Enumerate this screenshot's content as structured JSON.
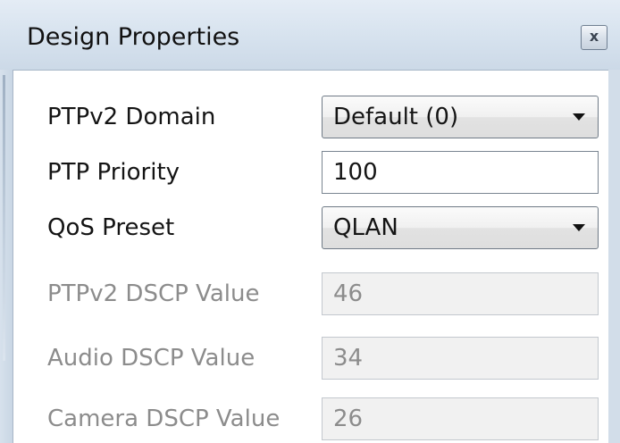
{
  "window": {
    "title": "Design Properties",
    "close_symbol": "x"
  },
  "fields": [
    {
      "label": "PTPv2 Domain",
      "type": "dropdown",
      "value": "Default (0)",
      "enabled": true
    },
    {
      "label": "PTP Priority",
      "type": "text",
      "value": "100",
      "enabled": true
    },
    {
      "label": "QoS Preset",
      "type": "dropdown",
      "value": "QLAN",
      "enabled": true
    },
    {
      "label": "PTPv2 DSCP Value",
      "type": "text",
      "value": "46",
      "enabled": false
    },
    {
      "label": "Audio DSCP Value",
      "type": "text",
      "value": "34",
      "enabled": false
    },
    {
      "label": "Camera DSCP Value",
      "type": "text",
      "value": "26",
      "enabled": false
    }
  ],
  "colors": {
    "frame": "#d6e2ee",
    "disabled_text": "#8c8c8c",
    "disabled_field": "#f1f1f1"
  },
  "icons": {
    "close": "close-icon",
    "dropdown_arrow": "chevron-down-icon"
  }
}
